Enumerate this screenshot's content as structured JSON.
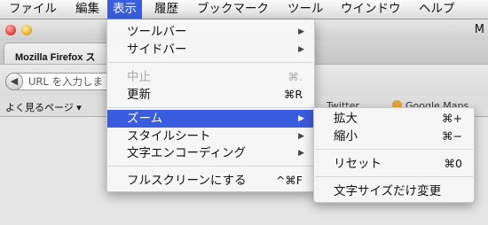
{
  "menubar": {
    "items": [
      {
        "label": "ファイル"
      },
      {
        "label": "編集"
      },
      {
        "label": "表示"
      },
      {
        "label": "履歴"
      },
      {
        "label": "ブックマーク"
      },
      {
        "label": "ツール"
      },
      {
        "label": "ウインドウ"
      },
      {
        "label": "ヘルプ"
      }
    ],
    "active_item": "表示",
    "highlight_color": "#3a5cde"
  },
  "browser": {
    "window_title_visible": "M",
    "active_tab_title": "Mozilla Firefox ス",
    "url_placeholder": "URL を入力しま",
    "bookmarks": {
      "most_visited": "よく見るページ ▾",
      "twitter": "Twitter",
      "google_maps": "Google Maps"
    }
  },
  "view_menu": {
    "items": [
      {
        "label": "ツールバー",
        "submenu": true
      },
      {
        "label": "サイドバー",
        "submenu": true
      },
      {
        "label": "中止",
        "shortcut": "⌘.",
        "disabled": true
      },
      {
        "label": "更新",
        "shortcut": "⌘R"
      },
      {
        "label": "ズーム",
        "submenu": true,
        "highlighted": true
      },
      {
        "label": "スタイルシート",
        "submenu": true
      },
      {
        "label": "文字エンコーディング",
        "submenu": true
      },
      {
        "label": "フルスクリーンにする",
        "shortcut": "^⌘F"
      }
    ]
  },
  "zoom_submenu": {
    "items": [
      {
        "label": "拡大",
        "shortcut": "⌘+"
      },
      {
        "label": "縮小",
        "shortcut": "⌘−"
      },
      {
        "label": "リセット",
        "shortcut": "⌘0"
      },
      {
        "label": "文字サイズだけ変更"
      }
    ]
  },
  "icons": {
    "submenu_arrow": "▶",
    "back": "◀"
  }
}
